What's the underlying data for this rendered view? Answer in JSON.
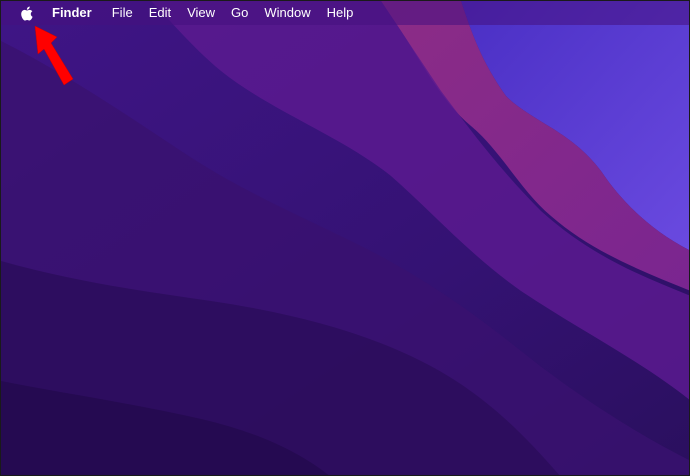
{
  "menubar": {
    "apple_icon": "apple-logo-icon",
    "app_name": "Finder",
    "items": [
      {
        "label": "File"
      },
      {
        "label": "Edit"
      },
      {
        "label": "View"
      },
      {
        "label": "Go"
      },
      {
        "label": "Window"
      },
      {
        "label": "Help"
      }
    ]
  },
  "annotation": {
    "arrow_icon": "red-arrow-icon",
    "color": "#ff0000"
  },
  "colors": {
    "wallpaper_dark": "#2a0f5e",
    "wallpaper_mid": "#4a1587",
    "wallpaper_magenta": "#8a2a7e",
    "wallpaper_blue": "#5a3ad0",
    "menubar_text": "#ffffff"
  }
}
